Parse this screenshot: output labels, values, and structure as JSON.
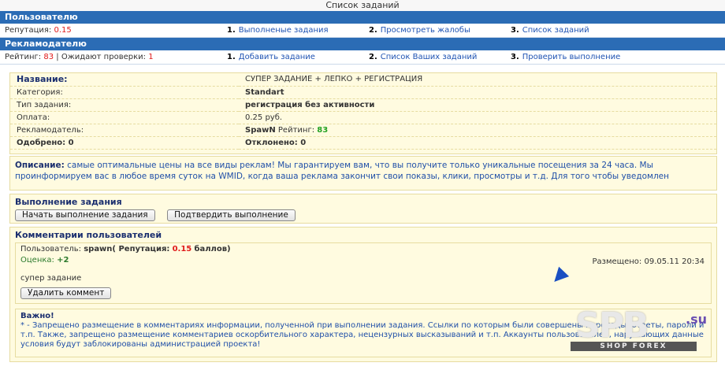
{
  "title": "Список заданий",
  "users_section": {
    "header": "Пользователю",
    "reputation_label": "Репутация:",
    "reputation_value": "0.15",
    "links": [
      {
        "num": "1.",
        "label": "Выполненые задания"
      },
      {
        "num": "2.",
        "label": "Просмотреть жалобы"
      },
      {
        "num": "3.",
        "label": "Список заданий"
      }
    ]
  },
  "advertiser_section": {
    "header": "Рекламодателю",
    "rating_label": "Рейтинг:",
    "rating_value": "83",
    "separator": "|",
    "pending_label": "Ожидают проверки:",
    "pending_value": "1",
    "links": [
      {
        "num": "1.",
        "label": "Добавить задание"
      },
      {
        "num": "2.",
        "label": "Список Ваших заданий"
      },
      {
        "num": "3.",
        "label": "Проверить выполнение"
      }
    ]
  },
  "task": {
    "name_label": "Название:",
    "name_value": "СУПЕР ЗАДАНИЕ + ЛЕПКО + РЕГИСТРАЦИЯ",
    "category_label": "Категория:",
    "category_value": "Standart",
    "type_label": "Тип задания:",
    "type_value": "регистрация без активности",
    "payment_label": "Оплата:",
    "payment_value": "0.25 руб.",
    "advertiser_label": "Рекламодатель:",
    "advertiser_name": "SpawN",
    "advertiser_rating_label": "Рейтинг:",
    "advertiser_rating_value": "83",
    "approved_label": "Одобрено:",
    "approved_value": "0",
    "rejected_label": "Отклонено:",
    "rejected_value": "0"
  },
  "description": {
    "label": "Описание:",
    "text": "самые оптимальные цены на все виды реклам! Мы гарантируем вам, что вы получите только уникальные посещения за 24 часа. Мы проинформируем вас в любое время суток на WMID, когда ваша реклама закончит свои показы, клики, просмотры и т.д. Для того чтобы уведомлен"
  },
  "execution": {
    "header": "Выполнение задания",
    "start_button": "Начать выполнение задания",
    "confirm_button": "Подтвердить выполнение"
  },
  "comments": {
    "header": "Комментарии пользователей",
    "items": [
      {
        "user_label": "Пользователь:",
        "user_name": "spawn",
        "reputation_label": "( Репутация:",
        "reputation_value": "0.15",
        "reputation_suffix": "баллов)",
        "score_label": "Оценка:",
        "score_value": "+2",
        "posted_label": "Размещено:",
        "posted_value": "09.05.11 20:34",
        "text": "супер задание",
        "delete_button": "Удалить коммент"
      }
    ]
  },
  "warning": {
    "header": "Важно!",
    "text": "* - Запрещено размещение в комментариях информации, полученной при выполнении задания. Ссылки по которым были совершены переходы, ответы, пароли и т.п. Также, запрещено размещение комментариев оскорбительного характера, нецензурных высказываний и т.п. Аккаунты пользователей, нарушающих данные условия будут заблокированы администрацией проекта!"
  },
  "watermark": {
    "logo": "SPB",
    "suffix": ".su",
    "band": "SHOP FOREX"
  },
  "colors": {
    "header_bar": "#2b6cb5",
    "panel_bg": "#fffbe0",
    "red": "#e01b1b",
    "green": "#23a223",
    "link": "#1f53b3"
  }
}
